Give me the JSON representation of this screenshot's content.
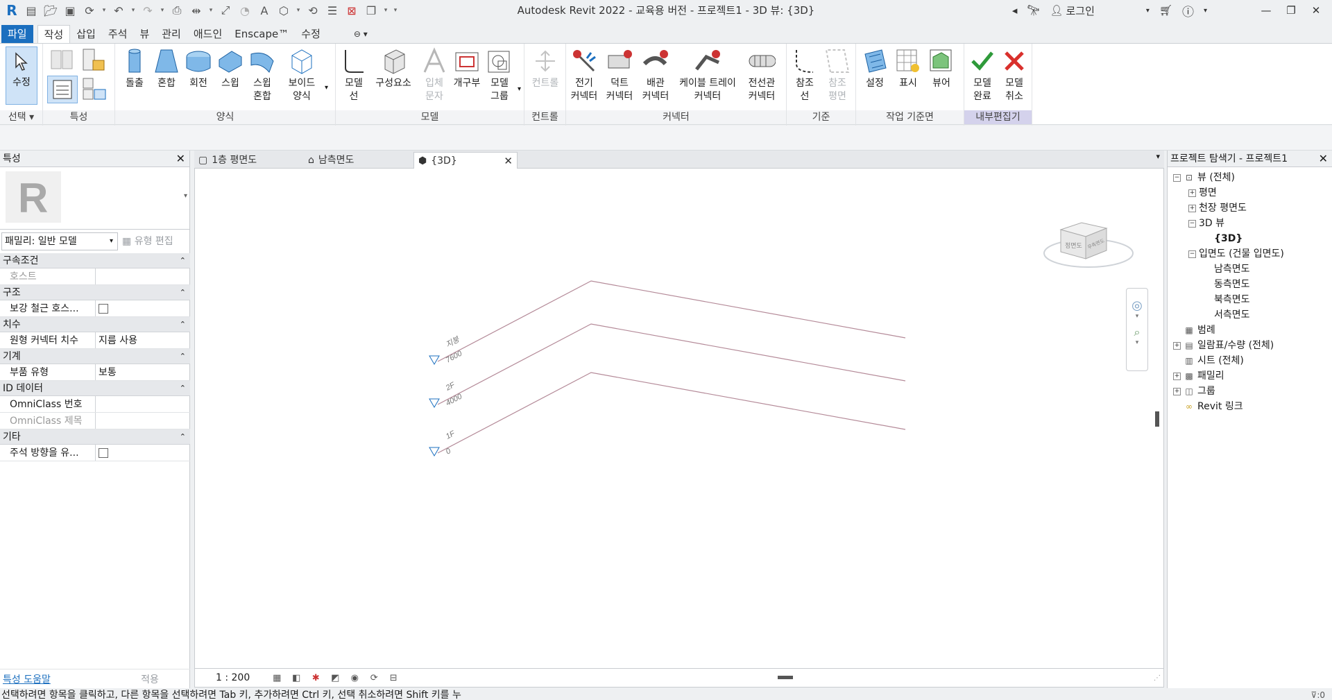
{
  "titlebar": {
    "title": "Autodesk Revit 2022 - 교육용 버전 - 프로젝트1 - 3D 뷰: {3D}",
    "login": "로그인"
  },
  "ribbon_tabs": [
    "파일",
    "작성",
    "삽입",
    "주석",
    "뷰",
    "관리",
    "애드인",
    "Enscape™",
    "수정"
  ],
  "ribbon": {
    "select": {
      "button": "수정",
      "dropdown": "선택"
    },
    "panels": {
      "properties": "특성",
      "forms": "양식",
      "model": "모델",
      "control": "컨트롤",
      "connector": "커넥터",
      "datum": "기준",
      "workplane": "작업 기준면",
      "inplace": "내부편집기"
    },
    "forms_buttons": [
      "돌출",
      "혼합",
      "회전",
      "스윕",
      "스윕\n혼합",
      "보이드\n양식"
    ],
    "model_buttons": [
      "모델\n선",
      "구성요소",
      "입체\n문자",
      "개구부",
      "모델\n그룹"
    ],
    "control_buttons": [
      "컨트롤"
    ],
    "connector_buttons": [
      "전기\n커넥터",
      "덕트\n커넥터",
      "배관\n커넥터",
      "케이블 트레이\n커넥터",
      "전선관\n커넥터"
    ],
    "datum_buttons": [
      "참조\n선",
      "참조\n평면"
    ],
    "workplane_buttons": [
      "설정",
      "표시",
      "뷰어"
    ],
    "inplace_buttons": [
      "모델\n완료",
      "모델\n취소"
    ]
  },
  "properties": {
    "header": "특성",
    "family": "패밀리: 일반 모델",
    "edit_type": "유형 편집",
    "groups": [
      {
        "name": "구속조건",
        "rows": [
          {
            "k": "호스트",
            "v": "",
            "dim": true
          }
        ]
      },
      {
        "name": "구조",
        "rows": [
          {
            "k": "보강 철근 호스...",
            "v": "checkbox"
          }
        ]
      },
      {
        "name": "치수",
        "rows": [
          {
            "k": "원형 커넥터 치수",
            "v": "지름 사용"
          }
        ]
      },
      {
        "name": "기계",
        "rows": [
          {
            "k": "부품 유형",
            "v": "보통"
          }
        ]
      },
      {
        "name": "ID 데이터",
        "rows": [
          {
            "k": "OmniClass 번호",
            "v": ""
          },
          {
            "k": "OmniClass 제목",
            "v": "",
            "dim": true
          }
        ]
      },
      {
        "name": "기타",
        "rows": [
          {
            "k": "주석 방향을 유...",
            "v": "checkbox"
          }
        ]
      }
    ],
    "help": "특성 도움말",
    "apply": "적용"
  },
  "view_tabs": [
    {
      "label": "1층 평면도",
      "icon": "floor-plan-icon"
    },
    {
      "label": "남측면도",
      "icon": "elevation-icon"
    },
    {
      "label": "{3D}",
      "icon": "3d-view-icon",
      "active": true
    }
  ],
  "levels": [
    {
      "name": "지붕",
      "elev": "7600"
    },
    {
      "name": "2F",
      "elev": "4000"
    },
    {
      "name": "1F",
      "elev": "0"
    }
  ],
  "viewcube": {
    "front": "정면도",
    "right": "우측면도"
  },
  "view_control": {
    "scale": "1 : 200"
  },
  "browser": {
    "header": "프로젝트 탐색기 - 프로젝트1",
    "nodes": [
      {
        "label": "뷰 (전체)",
        "level": 0,
        "toggle": "-"
      },
      {
        "label": "평면",
        "level": 1,
        "toggle": "+"
      },
      {
        "label": "천장 평면도",
        "level": 1,
        "toggle": "+"
      },
      {
        "label": "3D 뷰",
        "level": 1,
        "toggle": "-"
      },
      {
        "label": "{3D}",
        "level": 2,
        "toggle": "",
        "bold": true
      },
      {
        "label": "입면도 (건물 입면도)",
        "level": 1,
        "toggle": "-"
      },
      {
        "label": "남측면도",
        "level": 2,
        "toggle": ""
      },
      {
        "label": "동측면도",
        "level": 2,
        "toggle": ""
      },
      {
        "label": "북측면도",
        "level": 2,
        "toggle": ""
      },
      {
        "label": "서측면도",
        "level": 2,
        "toggle": ""
      },
      {
        "label": "범례",
        "level": 0,
        "toggle": ""
      },
      {
        "label": "일람표/수량 (전체)",
        "level": 0,
        "toggle": "+"
      },
      {
        "label": "시트 (전체)",
        "level": 0,
        "toggle": ""
      },
      {
        "label": "패밀리",
        "level": 0,
        "toggle": "+"
      },
      {
        "label": "그룹",
        "level": 0,
        "toggle": "+"
      },
      {
        "label": "Revit 링크",
        "level": 0,
        "toggle": ""
      }
    ]
  },
  "statusbar": {
    "message": "선택하려면 항목을 클릭하고, 다른 항목을 선택하려면 Tab 키, 추가하려면 Ctrl 키, 선택 취소하려면 Shift 키를 누",
    "filter_count": ":0"
  },
  "colors": {
    "accent": "#1b6fbf",
    "level_line": "#b48a98",
    "panel_bg": "#eef0f2"
  }
}
